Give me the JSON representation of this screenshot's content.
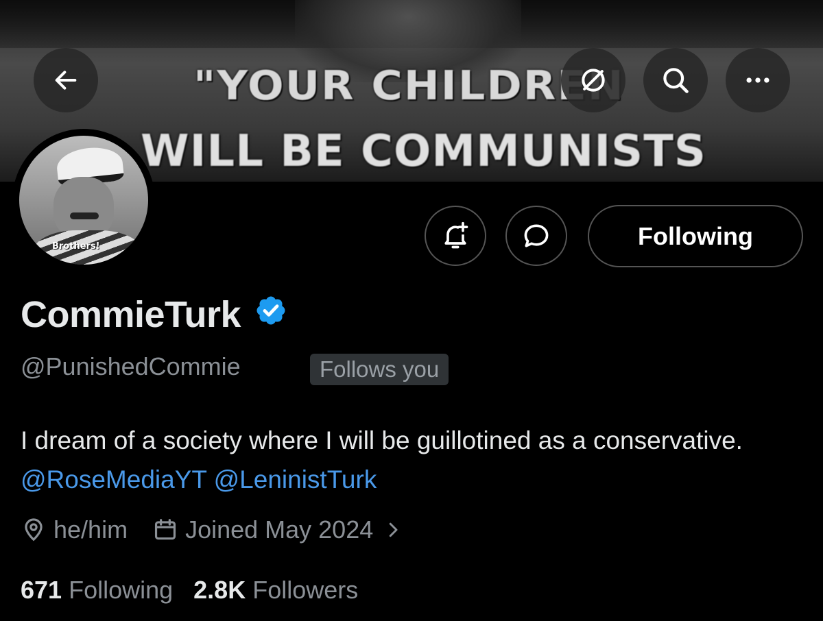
{
  "banner": {
    "line1": "\"YOUR CHILDREN",
    "line2": "WILL BE COMMUNISTS"
  },
  "avatar": {
    "caption": "Brothers!"
  },
  "actions": {
    "following_label": "Following"
  },
  "profile": {
    "display_name": "CommieTurk",
    "handle": "@PunishedCommie",
    "follows_you": "Follows you",
    "bio_text": "I dream of a society where I will be guillotined as a conservative. ",
    "bio_mentions": [
      "@RoseMediaYT",
      "@LeninistTurk"
    ],
    "pronouns": "he/him",
    "joined": "Joined May 2024",
    "following_count": "671",
    "following_label": "Following",
    "followers_count": "2.8K",
    "followers_label": "Followers"
  },
  "colors": {
    "accent": "#4a99e9",
    "verified": "#1d9bf0",
    "muted_text": "#8b9096"
  },
  "icons": {
    "back": "arrow-left-icon",
    "grok": "grok-icon",
    "search": "search-icon",
    "more": "more-icon",
    "notify": "bell-plus-icon",
    "message": "chat-bubble-icon",
    "verified": "verified-badge-icon",
    "location": "location-pin-icon",
    "calendar": "calendar-icon",
    "chevron": "chevron-right-icon"
  }
}
